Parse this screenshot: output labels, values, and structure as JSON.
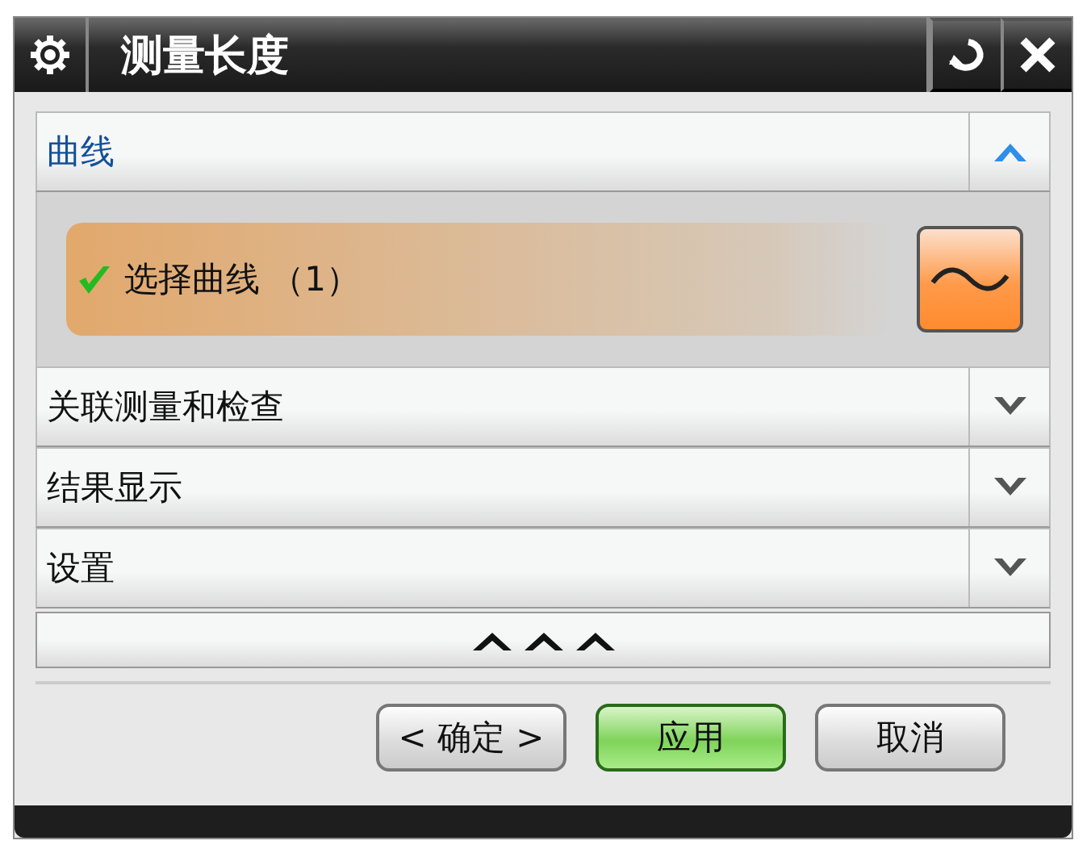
{
  "window": {
    "title": "测量长度"
  },
  "sections": [
    {
      "title": "曲线",
      "expanded": true,
      "selection": {
        "label": "选择曲线 （1）",
        "done": true
      }
    },
    {
      "title": "关联测量和检查",
      "expanded": false
    },
    {
      "title": "结果显示",
      "expanded": false
    },
    {
      "title": "设置",
      "expanded": false
    }
  ],
  "buttons": [
    {
      "label": "< 确定 >",
      "default": false
    },
    {
      "label": "应用",
      "default": true
    },
    {
      "label": "取消",
      "default": false
    }
  ]
}
